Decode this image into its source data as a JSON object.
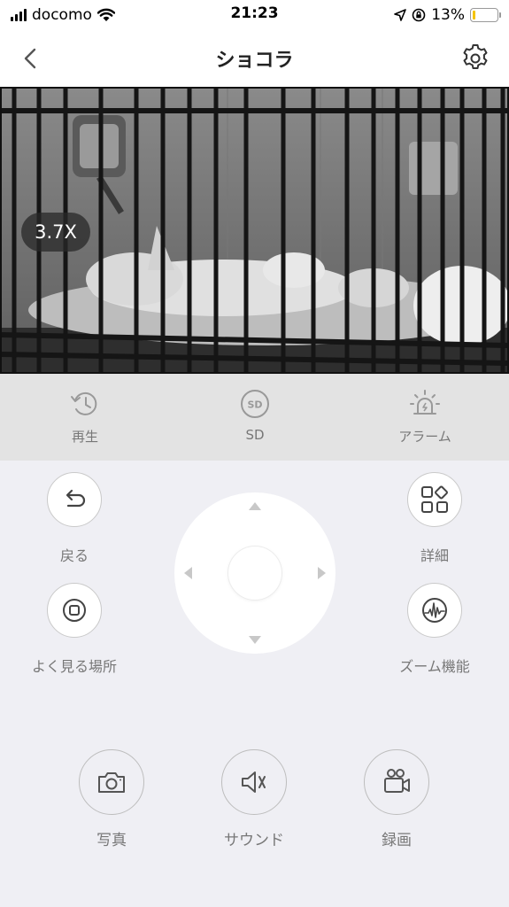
{
  "status_bar": {
    "carrier": "docomo",
    "time": "21:23",
    "battery_percent": "13%",
    "battery_level": 0.13,
    "battery_color": "#f5c400"
  },
  "nav": {
    "title": "ショコラ",
    "back_icon": "chevron-left-icon",
    "settings_icon": "gear-icon"
  },
  "video": {
    "zoom_level": "3.7X"
  },
  "functions": [
    {
      "label": "再生",
      "icon": "history-icon"
    },
    {
      "label": "SD",
      "icon": "sd-card-icon"
    },
    {
      "label": "アラーム",
      "icon": "alarm-siren-icon"
    }
  ],
  "controls": {
    "back_label": "戻る",
    "favorites_label": "よく見る場所",
    "details_label": "詳細",
    "zoom_label": "ズーム機能"
  },
  "actions": [
    {
      "label": "写真",
      "icon": "camera-icon"
    },
    {
      "label": "サウンド",
      "icon": "speaker-muted-icon"
    },
    {
      "label": "録画",
      "icon": "video-camera-icon"
    }
  ]
}
